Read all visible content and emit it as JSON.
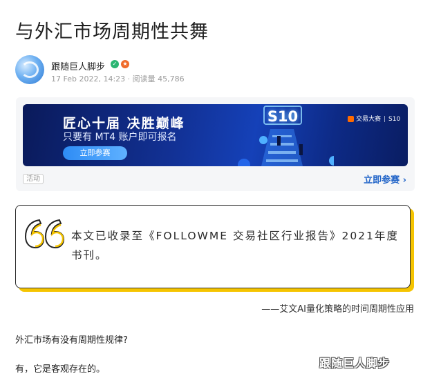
{
  "article": {
    "title": "与外汇市场周期性共舞",
    "author": "跟随巨人脚步",
    "date": "17 Feb 2022, 14:23",
    "views_label": "阅读量",
    "views": "45,786"
  },
  "promo": {
    "headline": "匠心十届  决胜巅峰",
    "subline": "只要有 MT4 账户即可报名",
    "button_label": "立即参赛",
    "badge": "S10",
    "brand_name": "交易大赛",
    "brand_season": "S10",
    "tag": "活动",
    "link_label": "立即参赛",
    "link_chevron": "›"
  },
  "quote": {
    "text": "本文已收录至《FOLLOWME 交易社区行业报告》2021年度书刊。",
    "source": "——艾文AI量化策略的时间周期性应用"
  },
  "body": {
    "p1": "外汇市场有没有周期性规律?",
    "p2": "有，它是客观存在的。"
  },
  "watermark": "跟随巨人脚步",
  "colors": {
    "accent_blue": "#2164c8",
    "quote_yellow": "#f5c400",
    "banner_navy": "#0d2a86"
  },
  "icons": {
    "verify": "verified-badge-icon",
    "rank": "rank-badge-icon",
    "quote": "quote-mark-icon"
  }
}
